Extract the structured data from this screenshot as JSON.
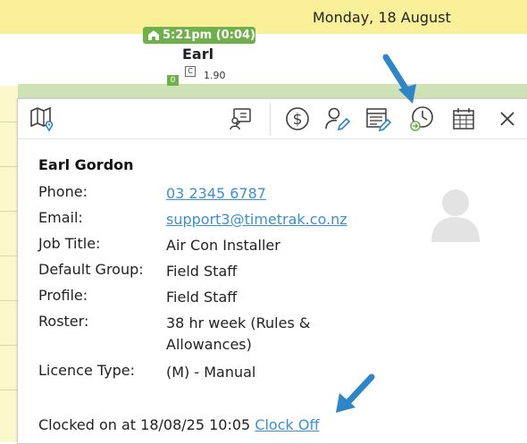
{
  "header": {
    "date": "Monday, 18 August"
  },
  "employee_column": {
    "clock_badge": "5:21pm (0:04)",
    "name": "Earl",
    "status_square": "0",
    "class_code": "C",
    "hours": "1.90"
  },
  "toolbar": {
    "icons": [
      "map-pin-icon",
      "chat-icon",
      "dollar-icon",
      "edit-user-icon",
      "edit-timesheet-icon",
      "clock-on-icon",
      "calendar-grid-icon",
      "close-icon"
    ]
  },
  "details": {
    "full_name": "Earl Gordon",
    "rows": [
      {
        "label": "Phone:",
        "value": "03 2345 6787"
      },
      {
        "label": "Email:",
        "value": "support3@timetrak.co.nz"
      },
      {
        "label": "Job Title:",
        "value": "Air Con Installer"
      },
      {
        "label": "Default Group:",
        "value": "Field Staff"
      },
      {
        "label": "Profile:",
        "value": "Field Staff"
      },
      {
        "label": "Roster:",
        "value": "38 hr week (Rules & Allowances)"
      },
      {
        "label": "Licence Type:",
        "value": "(M) - Manual"
      }
    ],
    "clocked_text": "Clocked on at 18/08/25 10:05",
    "clock_off_label": "Clock Off"
  },
  "colors": {
    "banner": "#fbf09a",
    "accent_green": "#6fb04a",
    "link": "#3a8fd6",
    "icon": "#3d3d3d",
    "annotation_arrow": "#2d86c7"
  }
}
